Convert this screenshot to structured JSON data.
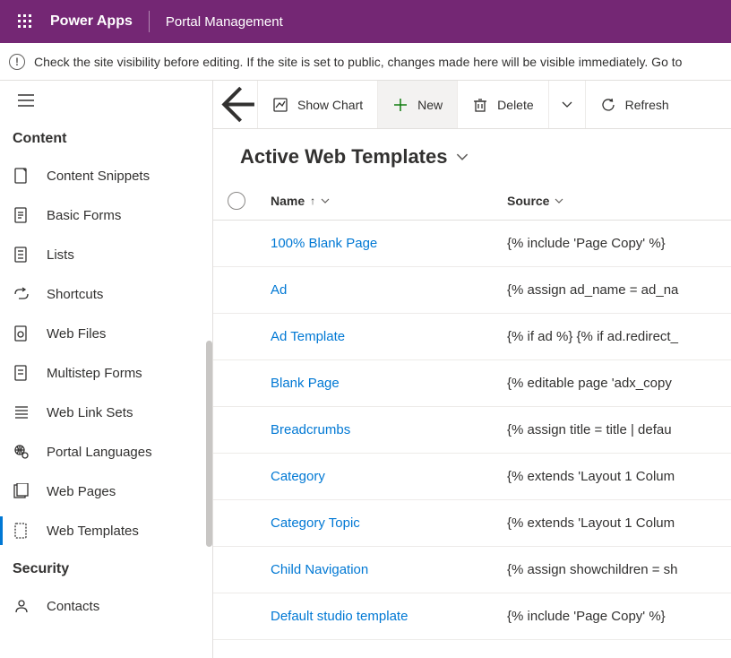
{
  "header": {
    "brand": "Power Apps",
    "appname": "Portal Management"
  },
  "notice": "Check the site visibility before editing. If the site is set to public, changes made here will be visible immediately. Go to",
  "sidebar": {
    "sections": {
      "content": {
        "label": "Content"
      },
      "security": {
        "label": "Security"
      }
    },
    "items": [
      {
        "label": "Content Snippets"
      },
      {
        "label": "Basic Forms"
      },
      {
        "label": "Lists"
      },
      {
        "label": "Shortcuts"
      },
      {
        "label": "Web Files"
      },
      {
        "label": "Multistep Forms"
      },
      {
        "label": "Web Link Sets"
      },
      {
        "label": "Portal Languages"
      },
      {
        "label": "Web Pages"
      },
      {
        "label": "Web Templates"
      }
    ],
    "security_items": [
      {
        "label": "Contacts"
      }
    ]
  },
  "commands": {
    "show_chart": "Show Chart",
    "new": "New",
    "delete": "Delete",
    "refresh": "Refresh"
  },
  "view": {
    "title": "Active Web Templates"
  },
  "columns": {
    "name": "Name",
    "source": "Source"
  },
  "rows": [
    {
      "name": "100% Blank Page",
      "source": "{% include 'Page Copy' %}"
    },
    {
      "name": "Ad",
      "source": "{% assign ad_name = ad_na"
    },
    {
      "name": "Ad Template",
      "source": "{% if ad %} {% if ad.redirect_"
    },
    {
      "name": "Blank Page",
      "source": "{% editable page 'adx_copy"
    },
    {
      "name": "Breadcrumbs",
      "source": "{% assign title = title | defau"
    },
    {
      "name": "Category",
      "source": "{% extends 'Layout 1 Colum"
    },
    {
      "name": "Category Topic",
      "source": "{% extends 'Layout 1 Colum"
    },
    {
      "name": "Child Navigation",
      "source": "{% assign showchildren = sh"
    },
    {
      "name": "Default studio template",
      "source": "{% include 'Page Copy' %}"
    }
  ]
}
